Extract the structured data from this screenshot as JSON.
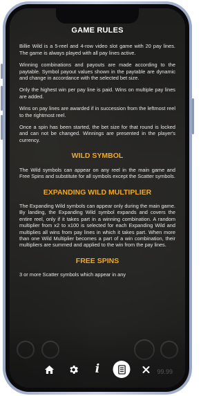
{
  "rules": {
    "title": "GAME RULES",
    "intro_paragraphs": [
      "Billie Wild is a 5-reel and 4-row video slot game with 20 pay lines. The game is always played with all pay lines active.",
      "Winning combinations and payouts are made according to the paytable. Symbol payout values shown in the paytable are dynamic and change in accordance with the selected bet size.",
      "Only the highest win per pay line is paid. Wins on multiple pay lines are added.",
      "Wins on pay lines are awarded if in succession from the leftmost reel to the rightmost reel.",
      "Once a spin has been started, the bet size for that round is locked and can not be changed. Winnings are presented in the player's currency."
    ],
    "wild_symbol": {
      "heading": "WILD SYMBOL",
      "text": "The Wild symbols can appear on any reel in the main game and Free Spins and substitute for all symbols except the Scatter symbols."
    },
    "expanding_wild": {
      "heading": "EXPANDING WILD MULTIPLIER",
      "text": "The Expanding Wild symbols can appear only during the main game. By landing, the Expanding Wild symbol expands and covers the entire reel, only if it takes part in a winning combination. A random multiplier from x2 to x100 is selected for each Expanding Wild and multiplies all wins from pay lines in which it takes part. When more than one Wild Multiplier becomes a part of a win combination, their multipliers are summed and applied to the win from the pay lines."
    },
    "free_spins": {
      "heading": "FREE SPINS",
      "text": "3 or more Scatter symbols which appear in any"
    }
  },
  "background": {
    "balance_partial": "99.99"
  },
  "toolbar": {
    "buttons": [
      {
        "name": "home",
        "icon": "home-icon",
        "active": false
      },
      {
        "name": "settings",
        "icon": "gear-icon",
        "active": false
      },
      {
        "name": "info",
        "icon": "info-icon",
        "active": false
      },
      {
        "name": "paytable",
        "icon": "document-icon",
        "active": true
      },
      {
        "name": "close",
        "icon": "close-icon",
        "active": false
      }
    ]
  },
  "colors": {
    "heading": "#f0a827",
    "text": "#e9e9e9",
    "overlay": "#141414"
  }
}
